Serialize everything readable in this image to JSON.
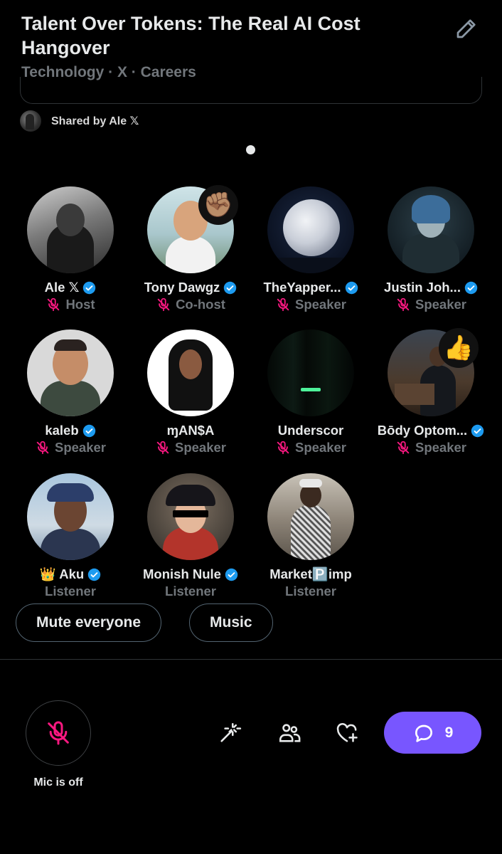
{
  "space": {
    "title": "Talent Over Tokens: The Real AI Cost Hangover",
    "tags": "Technology · X · Careers",
    "shared_by": "Shared by Ale 𝕏"
  },
  "participants": [
    {
      "name": "Ale 𝕏",
      "verified": true,
      "role": "Host",
      "mic_off": true,
      "avatar": "bearded man city street",
      "reaction": ""
    },
    {
      "name": "Tony Dawgz",
      "verified": true,
      "role": "Co-host",
      "mic_off": true,
      "avatar": "cartoon boy with guitar",
      "reaction": "✊🏽"
    },
    {
      "name": "TheYapper...",
      "verified": true,
      "role": "Speaker",
      "mic_off": true,
      "avatar": "full moon",
      "reaction": ""
    },
    {
      "name": "Justin Joh...",
      "verified": true,
      "role": "Speaker",
      "mic_off": true,
      "avatar": "blue haired armored woman",
      "reaction": ""
    },
    {
      "name": "kaleb",
      "verified": true,
      "role": "Speaker",
      "mic_off": true,
      "avatar": "smiling man",
      "reaction": ""
    },
    {
      "name": "ɱAN$A",
      "verified": false,
      "role": "Speaker",
      "mic_off": true,
      "avatar": "long haired man on white",
      "reaction": ""
    },
    {
      "name": "Underscor",
      "verified": false,
      "role": "Speaker",
      "mic_off": true,
      "avatar": "dark green dash",
      "reaction": ""
    },
    {
      "name": "Bōdy Optom...",
      "verified": true,
      "role": "Speaker",
      "mic_off": true,
      "avatar": "man at podium",
      "reaction": "👍"
    },
    {
      "name": "👑 Aku",
      "verified": true,
      "role": "Listener",
      "mic_off": false,
      "avatar": "woman with beret",
      "reaction": ""
    },
    {
      "name": "Monish Nule",
      "verified": true,
      "role": "Listener",
      "mic_off": false,
      "avatar": "anime guy with sunglasses",
      "reaction": ""
    },
    {
      "name": "Market🅿️imp",
      "verified": false,
      "role": "Listener",
      "mic_off": false,
      "avatar": "man in patterned suit",
      "reaction": ""
    }
  ],
  "actions": {
    "mute_everyone": "Mute everyone",
    "music": "Music"
  },
  "footer": {
    "mic_label": "Mic is off",
    "comment_count": "9"
  },
  "icons": {
    "edit": "pencil-icon",
    "verified": "verified-badge-icon",
    "mic_off": "mic-off-icon",
    "effects": "magic-wand-icon",
    "people": "people-icon",
    "favorite": "heart-plus-icon",
    "comment": "comment-bubble-icon"
  },
  "colors": {
    "background": "#000000",
    "text": "#e7e9ea",
    "muted": "#71767b",
    "mic_off": "#f91880",
    "verified": "#1d9bf0",
    "comment_button": "#7856ff"
  }
}
